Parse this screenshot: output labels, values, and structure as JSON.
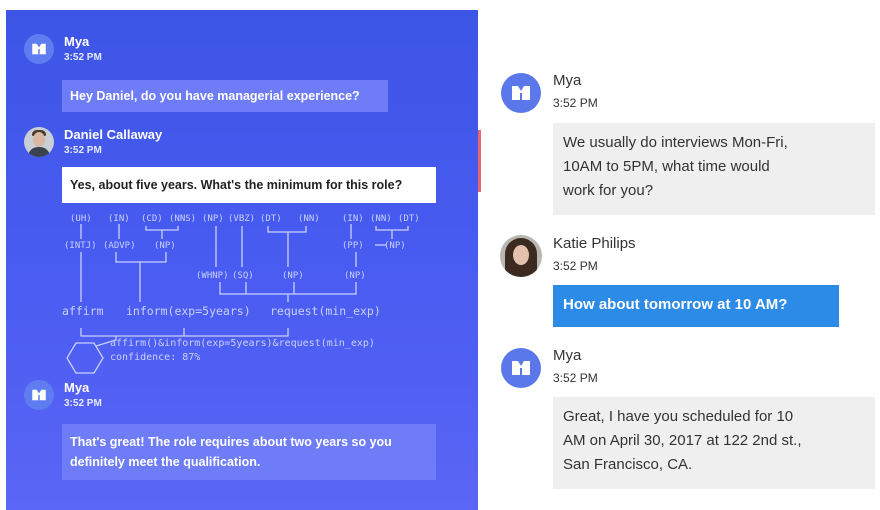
{
  "left_chat": {
    "messages": [
      {
        "sender": "Mya",
        "time": "3:52 PM",
        "text": "Hey Daniel, do you have managerial experience?"
      },
      {
        "sender": "Daniel Callaway",
        "time": "3:52 PM",
        "text": "Yes, about five years. What's the minimum for this role?"
      },
      {
        "sender": "Mya",
        "time": "3:52 PM",
        "text_line1": "That's great! The role requires about two years so you",
        "text_line2": "definitely meet the qualification."
      }
    ],
    "parse": {
      "pos_tags": [
        "(UH)",
        "(IN)",
        "(CD)",
        "(NNS)",
        "(NP)",
        "(VBZ)",
        "(DT)",
        "(NN)",
        "(IN)",
        "(NN)",
        "(DT)"
      ],
      "phrase_tags": [
        "(INTJ)",
        "(ADVP)",
        "(NP)",
        "(PP)",
        "(NP)"
      ],
      "sub_tags": [
        "(WHNP)",
        "(SQ)",
        "(NP)",
        "(NP)"
      ],
      "dialog_acts": [
        "affirm",
        "inform(exp=5years)",
        "request(min_exp)"
      ],
      "combined": "affirm()&inform(exp=5years)&request(min_exp)",
      "confidence": "confidence: 87%"
    }
  },
  "right_chat": {
    "messages": [
      {
        "sender": "Mya",
        "time": "3:52 PM",
        "lines": [
          "We usually do interviews Mon-Fri,",
          "10AM to 5PM, what time would",
          "work for you?"
        ]
      },
      {
        "sender": "Katie Philips",
        "time": "3:52 PM",
        "text": "How about tomorrow at 10 AM?"
      },
      {
        "sender": "Mya",
        "time": "3:52 PM",
        "lines": [
          "Great, I have you scheduled for 10",
          "AM on April 30, 2017 at 122 2nd st.,",
          "San Francisco, CA."
        ]
      }
    ]
  },
  "colors": {
    "left_bg": "#4a5cf2",
    "bot_bubble": "#6e7cf8",
    "user_bubble_right": "#2d8be8",
    "bot_bubble_right": "#efefef",
    "divider": "#e56670"
  },
  "icons": [
    "mya-logo-icon"
  ]
}
